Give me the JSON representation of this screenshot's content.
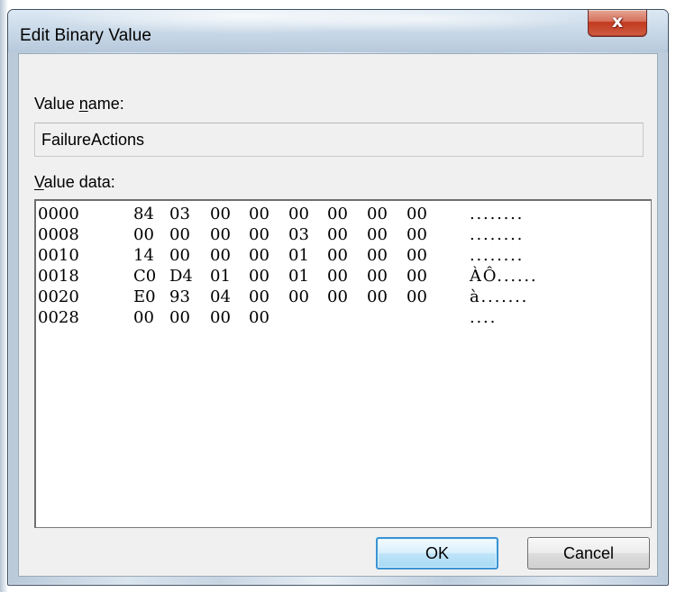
{
  "dialog": {
    "title": "Edit Binary Value",
    "close_label": "x",
    "value_name_label_prefix": "Value ",
    "value_name_label_mnemonic": "n",
    "value_name_label_suffix": "ame:",
    "value_name": "FailureActions",
    "value_data_label_mnemonic": "V",
    "value_data_label_suffix": "alue data:",
    "ok_label": "OK",
    "cancel_label": "Cancel"
  },
  "hex_data": {
    "rows": [
      {
        "offset": "0000",
        "bytes": [
          "84",
          "03",
          "00",
          "00",
          "00",
          "00",
          "00",
          "00"
        ],
        "ascii": "........"
      },
      {
        "offset": "0008",
        "bytes": [
          "00",
          "00",
          "00",
          "00",
          "03",
          "00",
          "00",
          "00"
        ],
        "ascii": "........"
      },
      {
        "offset": "0010",
        "bytes": [
          "14",
          "00",
          "00",
          "00",
          "01",
          "00",
          "00",
          "00"
        ],
        "ascii": "........"
      },
      {
        "offset": "0018",
        "bytes": [
          "C0",
          "D4",
          "01",
          "00",
          "01",
          "00",
          "00",
          "00"
        ],
        "ascii": "ÀÔ......"
      },
      {
        "offset": "0020",
        "bytes": [
          "E0",
          "93",
          "04",
          "00",
          "00",
          "00",
          "00",
          "00"
        ],
        "ascii": "à......."
      },
      {
        "offset": "0028",
        "bytes": [
          "00",
          "00",
          "00",
          "00",
          "",
          "",
          "",
          ""
        ],
        "ascii": "...."
      }
    ]
  }
}
